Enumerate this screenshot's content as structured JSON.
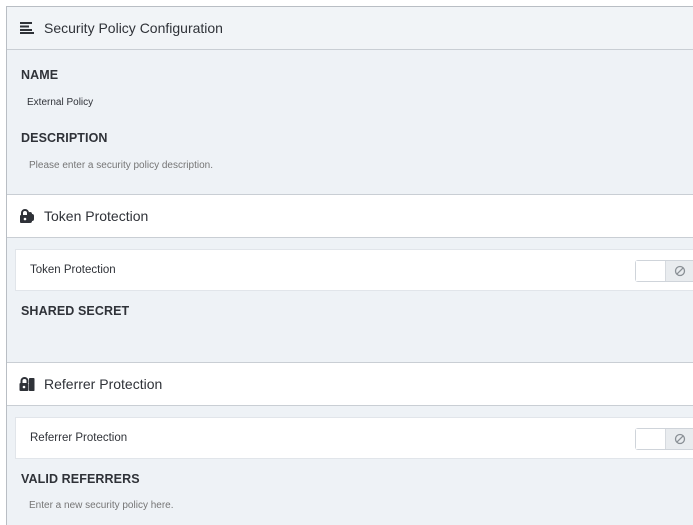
{
  "panel": {
    "title": "Security Policy Configuration",
    "title_icon": "list-icon"
  },
  "general": {
    "name_label": "NAME",
    "name_value": "External Policy",
    "description_label": "DESCRIPTION",
    "description_placeholder": "Please enter a security policy description."
  },
  "token_section": {
    "title": "Token Protection",
    "icon": "token-lock-icon",
    "toggle_label": "Token Protection",
    "toggle_state": "off",
    "shared_secret_label": "SHARED SECRET"
  },
  "referrer_section": {
    "title": "Referrer Protection",
    "icon": "referrer-lock-icon",
    "toggle_label": "Referrer Protection",
    "toggle_state": "off",
    "valid_referrers_label": "VALID REFERRERS",
    "valid_referrers_placeholder": "Enter a new security policy here."
  },
  "colors": {
    "panel_bg": "#eef2f6",
    "section_header_bg": "#ffffff",
    "text": "#2f3238",
    "placeholder": "#8a9096"
  }
}
